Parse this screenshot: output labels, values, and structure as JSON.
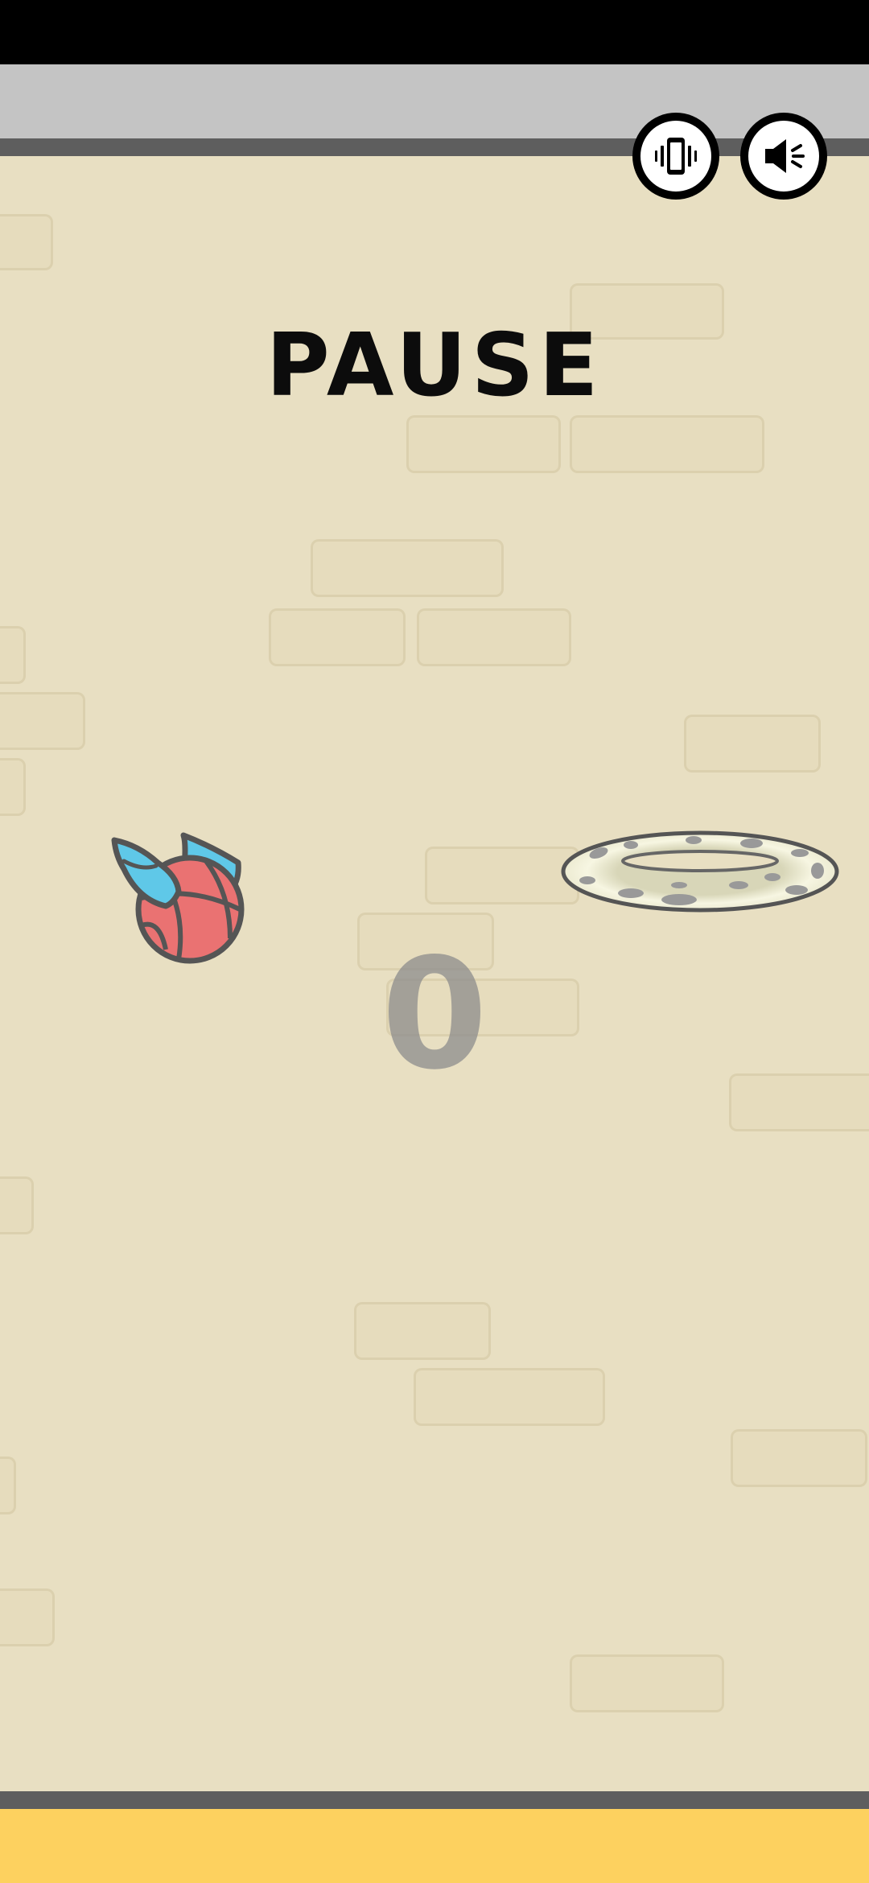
{
  "game": {
    "pause_title": "PAUSE",
    "score": "0"
  },
  "controls": {
    "vibrate_icon": "vibrate-icon",
    "sound_icon": "speaker-sound-icon"
  },
  "colors": {
    "background": "#e8dfc2",
    "ball": "#ea7272",
    "wings": "#5fc8e8",
    "hoop": "#f4f2d8",
    "bottom_bar": "#fdd15f",
    "top_bar": "#c4c4c4"
  }
}
